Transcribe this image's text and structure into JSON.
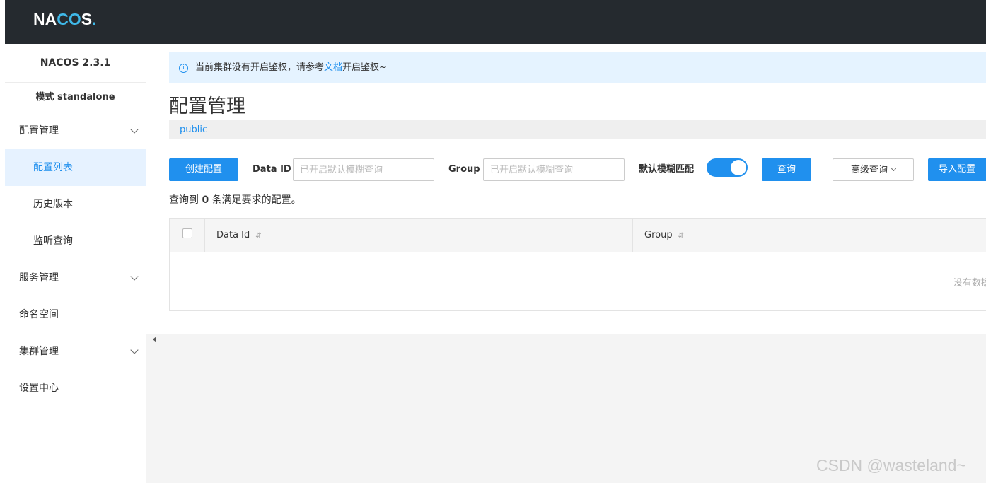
{
  "header": {
    "logo_left": "NA",
    "logo_mid": "CO",
    "logo_right": "S",
    "logo_dot": "."
  },
  "sidebar": {
    "version": "NACOS 2.3.1",
    "mode": "模式 standalone",
    "items": [
      {
        "label": "配置管理",
        "expandable": true
      },
      {
        "label": "配置列表",
        "active": true
      },
      {
        "label": "历史版本"
      },
      {
        "label": "监听查询"
      },
      {
        "label": "服务管理",
        "expandable": true
      },
      {
        "label": "命名空间"
      },
      {
        "label": "集群管理",
        "expandable": true
      },
      {
        "label": "设置中心"
      }
    ]
  },
  "alert": {
    "prefix": "当前集群没有开启鉴权，请参考",
    "link": "文档",
    "suffix": "开启鉴权~"
  },
  "page_title": "配置管理",
  "namespace": "public",
  "toolbar": {
    "create_label": "创建配置",
    "data_id_label": "Data ID",
    "data_id_placeholder": "已开启默认模糊查询",
    "group_label": "Group",
    "group_placeholder": "已开启默认模糊查询",
    "fuzzy_label": "默认模糊匹配",
    "fuzzy_on": true,
    "query_label": "查询",
    "advanced_label": "高级查询",
    "import_label": "导入配置"
  },
  "result": {
    "prefix": "查询到",
    "count": "0",
    "suffix": "条满足要求的配置。"
  },
  "table": {
    "columns": [
      "Data Id",
      "Group"
    ],
    "sort_glyph": "⇵",
    "empty_text": "没有数据"
  },
  "watermark": "CSDN @wasteland~",
  "colors": {
    "accent": "#2090ee",
    "topbar": "#252a2f",
    "active_bg": "#e6f2ff"
  }
}
